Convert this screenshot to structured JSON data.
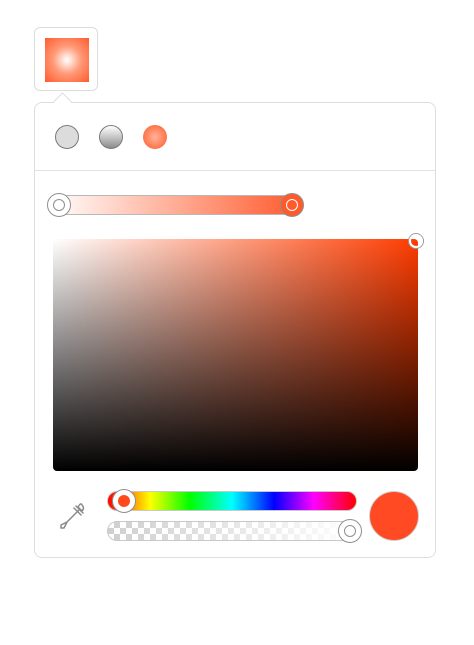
{
  "picker": {
    "trigger_swatch": {
      "gradient_type": "radial",
      "colors": [
        "#ffffff",
        "#ff5a2c"
      ]
    },
    "gradient_types": [
      {
        "name": "solid",
        "selected": false
      },
      {
        "name": "linear",
        "selected": false
      },
      {
        "name": "radial",
        "selected": true
      }
    ],
    "gradient_stops": [
      {
        "color": "#ffffff",
        "position": 0.0
      },
      {
        "color": "#ff5a2c",
        "position": 1.0
      }
    ],
    "hue_color": "#ff3c00",
    "hue_fraction": 0.05,
    "alpha": 1.0,
    "current_color": "#ff4a24",
    "eyedropper_icon": "eyedropper-icon"
  }
}
